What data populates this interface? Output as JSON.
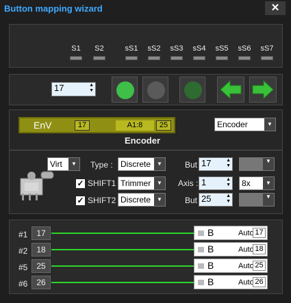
{
  "window": {
    "title": "Button mapping wizard",
    "close_glyph": "✕"
  },
  "status_leds": [
    "S1",
    "S2",
    "sS1",
    "sS2",
    "sS3",
    "sS4",
    "sS5",
    "sS6",
    "sS7"
  ],
  "toolbar": {
    "index_value": "17"
  },
  "display": {
    "name": "EnV",
    "index": "17",
    "axis": "A1:8",
    "button": "25"
  },
  "mode_select": "Encoder",
  "mode_heading": "Encoder",
  "config": {
    "virt": "Virt",
    "type_label": "Type :",
    "type_value": "Discrete",
    "but_label": "But",
    "but_value": "17",
    "shift1_label": "SHIFT1",
    "shift1_value": "Trimmer",
    "axis_label": "Axis :",
    "axis_value": "1",
    "axis_mult": "8x",
    "shift2_label": "SHIFT2",
    "shift2_value": "Discrete",
    "but2_label": "But",
    "but2_value": "25"
  },
  "mappings": [
    {
      "num": "#1",
      "input": "17",
      "letter": "B",
      "mode": "Auto",
      "out": "17"
    },
    {
      "num": "#2",
      "input": "18",
      "letter": "B",
      "mode": "Auto",
      "out": "18"
    },
    {
      "num": "#5",
      "input": "25",
      "letter": "B",
      "mode": "Auto",
      "out": "25"
    },
    {
      "num": "#6",
      "input": "26",
      "letter": "B",
      "mode": "Auto",
      "out": "26"
    }
  ],
  "colors": {
    "accent": "#3fa9ff",
    "led_green": "#2bd62b",
    "display_bg": "#8f8f14"
  }
}
